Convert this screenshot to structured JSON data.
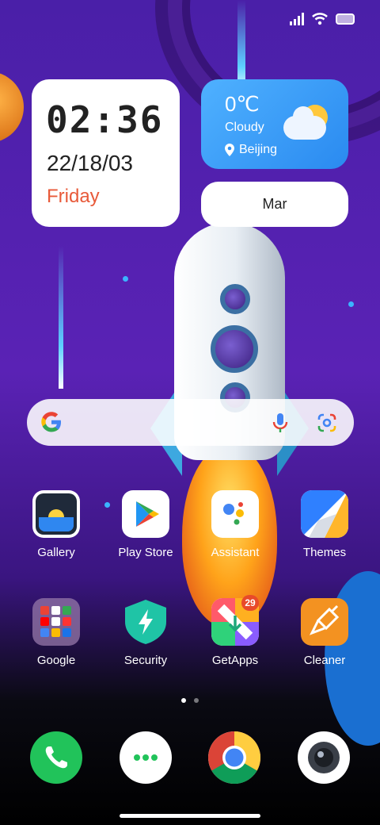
{
  "status_bar": {
    "icons": [
      "signal-icon",
      "wifi-icon",
      "battery-icon"
    ]
  },
  "clock_widget": {
    "time": "02:36",
    "date": "22/18/03",
    "day": "Friday",
    "day_color": "#e85a3a"
  },
  "weather_widget": {
    "temperature": "0℃",
    "condition": "Cloudy",
    "location": "Beijing"
  },
  "month_widget": {
    "label": "Mar"
  },
  "search_bar": {
    "icons": [
      "google-g-icon",
      "microphone-icon",
      "google-lens-icon"
    ]
  },
  "apps_row1": [
    {
      "label": "Gallery"
    },
    {
      "label": "Play Store"
    },
    {
      "label": "Assistant"
    },
    {
      "label": "Themes"
    }
  ],
  "apps_row2": [
    {
      "label": "Google"
    },
    {
      "label": "Security"
    },
    {
      "label": "GetApps",
      "badge": "29"
    },
    {
      "label": "Cleaner"
    }
  ],
  "pager": {
    "pages": 2,
    "current": 1
  },
  "dock": [
    {
      "icon": "phone-icon"
    },
    {
      "icon": "messages-icon"
    },
    {
      "icon": "chrome-icon"
    },
    {
      "icon": "camera-icon"
    }
  ]
}
